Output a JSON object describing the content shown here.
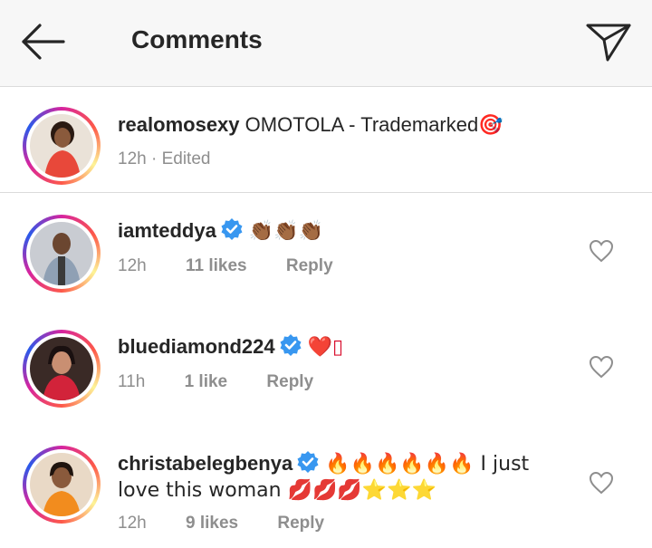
{
  "header": {
    "title": "Comments"
  },
  "caption": {
    "username": "realomosexy",
    "text": "OMOTOLA - Trademarked🎯",
    "meta": "12h · Edited"
  },
  "comments": [
    {
      "username": "iamteddya",
      "verified": true,
      "text": "👏🏾👏🏾👏🏾",
      "time": "12h",
      "likes": "11 likes",
      "reply": "Reply"
    },
    {
      "username": "bluediamond224",
      "verified": true,
      "text": "❤️▯",
      "time": "11h",
      "likes": "1 like",
      "reply": "Reply"
    },
    {
      "username": "christabelegbenya",
      "verified": true,
      "text_line1": "🔥🔥🔥🔥🔥🔥 I just",
      "text_line2": "love this woman 💋💋💋⭐⭐⭐",
      "time": "12h",
      "likes": "9 likes",
      "reply": "Reply"
    }
  ],
  "icons": {
    "back": "arrow-left-icon",
    "send": "paper-plane-icon",
    "heart": "heart-outline-icon",
    "verified": "verified-badge-icon"
  },
  "colors": {
    "verified": "#3897f0",
    "meta_gray": "#8e8e8e",
    "header_bg": "#f7f7f7"
  }
}
